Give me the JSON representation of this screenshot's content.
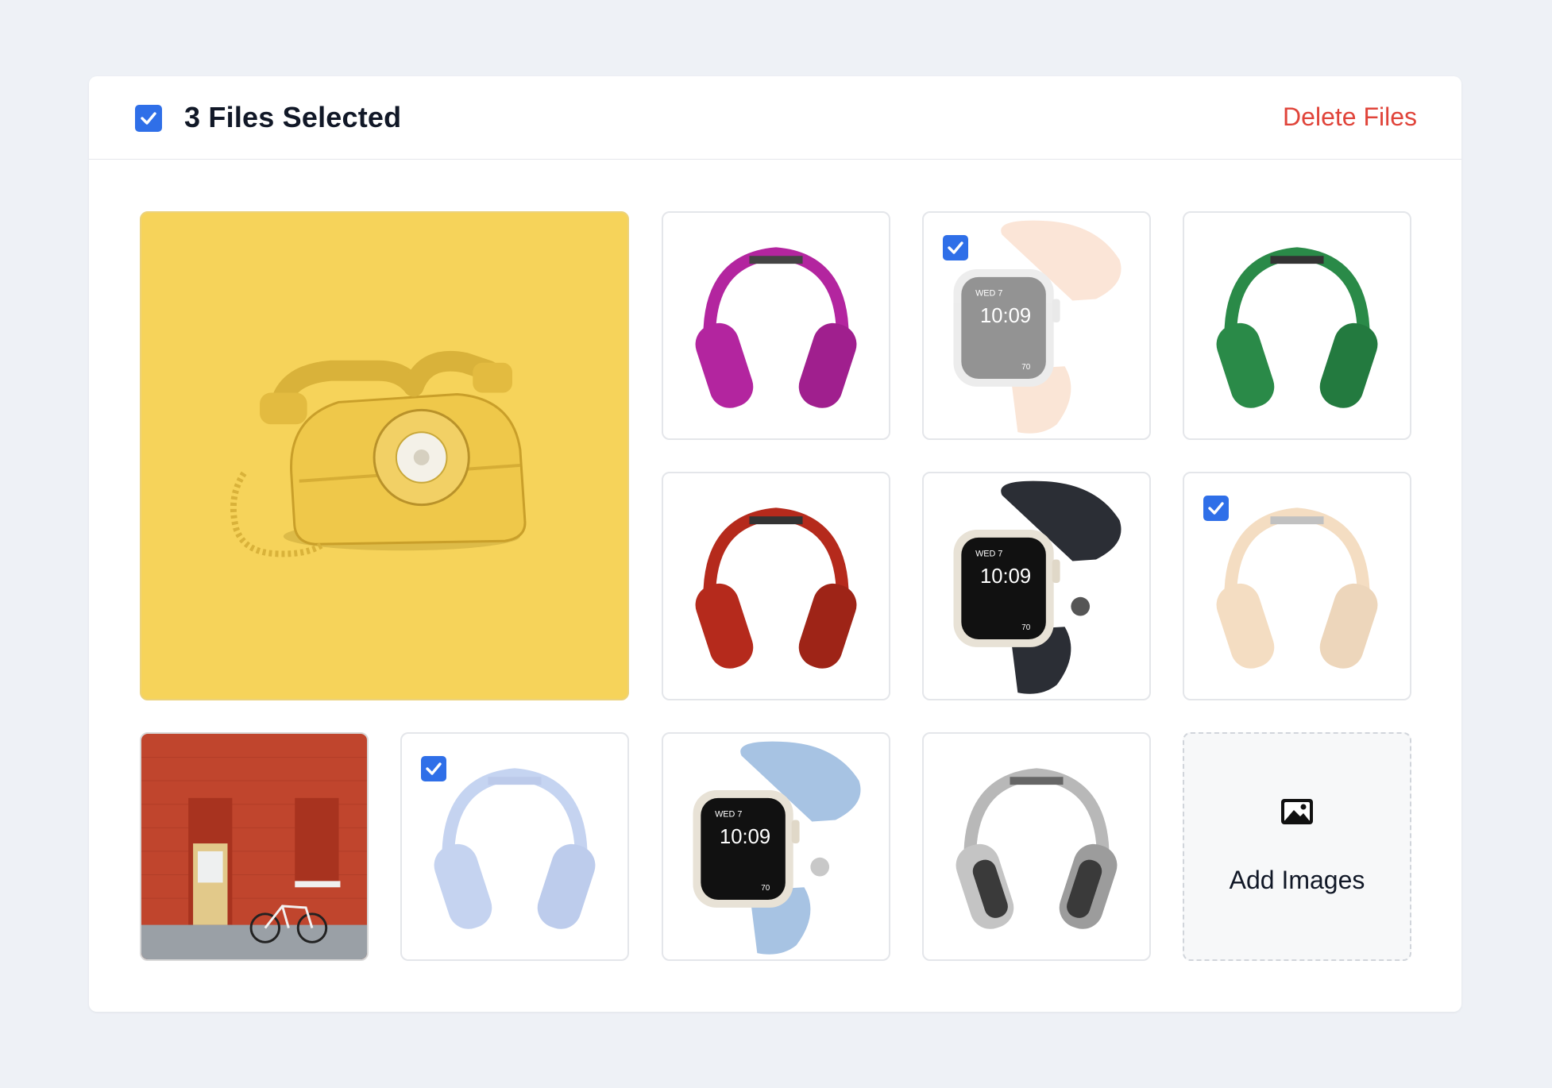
{
  "header": {
    "selected_count_label": "3 Files Selected",
    "delete_label": "Delete Files",
    "all_checked": true
  },
  "tiles": [
    {
      "id": "yellow-telephone",
      "subject": "yellow rotary telephone",
      "bg_color": "#f6d35a",
      "item_color": "#efc84a",
      "selected": false
    },
    {
      "id": "magenta-headphones",
      "subject": "headphones",
      "item_color": "#b3259f",
      "selected": false
    },
    {
      "id": "peach-watch",
      "subject": "smartwatch",
      "item_color": "#f6c6a6",
      "selected": true
    },
    {
      "id": "green-headphones",
      "subject": "headphones",
      "item_color": "#2a8a48",
      "selected": false
    },
    {
      "id": "red-headphones",
      "subject": "headphones",
      "item_color": "#b52a1c",
      "selected": false
    },
    {
      "id": "midnight-watch",
      "subject": "smartwatch",
      "item_color": "#2b2e35",
      "selected": false
    },
    {
      "id": "tan-headphones",
      "subject": "headphones",
      "item_color": "#e7b57a",
      "selected": true
    },
    {
      "id": "red-brick-building",
      "subject": "red brick wall with door and bicycle",
      "item_color": "#c0452d",
      "selected": false
    },
    {
      "id": "blue-headphones",
      "subject": "headphones",
      "item_color": "#7f9fe0",
      "selected": true
    },
    {
      "id": "light-blue-watch",
      "subject": "smartwatch",
      "item_color": "#a7c3e3",
      "selected": false
    },
    {
      "id": "silver-headphones",
      "subject": "headphones",
      "item_color": "#b8b8b8",
      "selected": false
    }
  ],
  "watch_face": {
    "day": "WED 7",
    "time": "10:09",
    "complication": "70"
  },
  "add_images": {
    "label": "Add Images",
    "icon": "image-icon"
  },
  "colors": {
    "accent": "#2f6fe8",
    "danger": "#e0443a",
    "background": "#eef1f6"
  }
}
